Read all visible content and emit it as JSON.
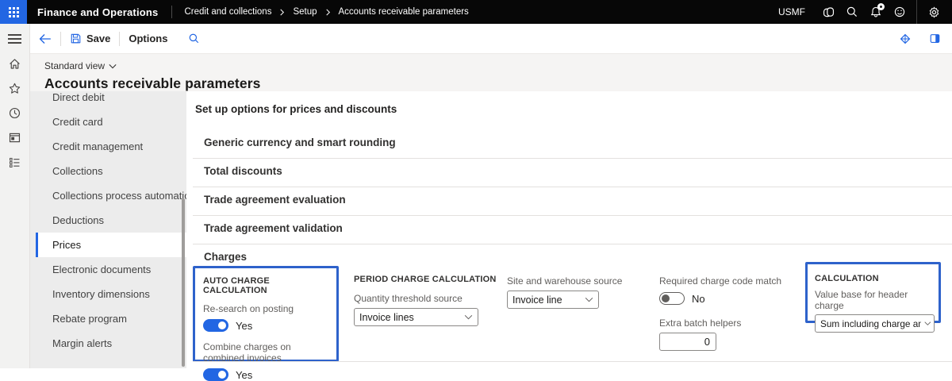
{
  "topbar": {
    "app_name": "Finance and Operations",
    "breadcrumb": [
      "Credit and collections",
      "Setup",
      "Accounts receivable parameters"
    ],
    "company": "USMF",
    "icons": {
      "waffle": "app-launcher",
      "copilot": "copilot",
      "search": "search",
      "alerts": "notification-bell",
      "feedback": "feedback-smiley",
      "settings": "gear"
    }
  },
  "action_bar": {
    "save_label": "Save",
    "options_label": "Options",
    "icons": {
      "back": "back-arrow",
      "save": "floppy-disk",
      "search": "search",
      "right1": "diamond",
      "right2": "side-panel-toggle"
    }
  },
  "page": {
    "view_selector": "Standard view",
    "title": "Accounts receivable parameters"
  },
  "nav_rail": {
    "icons": [
      "menu-hamburger",
      "home",
      "favorites-star",
      "recent-clock",
      "worklist-window",
      "nav-list"
    ]
  },
  "sidebar": {
    "items": [
      "Direct debit",
      "Credit card",
      "Credit management",
      "Collections",
      "Collections process automation",
      "Deductions",
      "Prices",
      "Electronic documents",
      "Inventory dimensions",
      "Rebate program",
      "Margin alerts"
    ],
    "selected": "Prices"
  },
  "content": {
    "heading": "Set up options for prices and discounts",
    "sections": [
      "Generic currency and smart rounding",
      "Total discounts",
      "Trade agreement evaluation",
      "Trade agreement validation",
      "Charges"
    ],
    "charges": {
      "auto_charge": {
        "title": "AUTO CHARGE CALCULATION",
        "highlighted": true,
        "toggles": [
          {
            "label": "Re-search on posting",
            "value": "Yes",
            "on": true
          },
          {
            "label": "Combine charges on combined invoices",
            "value": "Yes",
            "on": true
          }
        ]
      },
      "period_charge": {
        "title": "PERIOD CHARGE CALCULATION",
        "field": {
          "label": "Quantity threshold source",
          "value": "Invoice lines"
        }
      },
      "site_warehouse": {
        "label": "Site and warehouse source",
        "value": "Invoice line"
      },
      "charge_code": {
        "label": "Required charge code match",
        "value": "No",
        "on": false
      },
      "batch_helpers": {
        "label": "Extra batch helpers",
        "value": "0"
      },
      "calculation": {
        "title": "CALCULATION",
        "highlighted": true,
        "field": {
          "label": "Value base for header charge",
          "value": "Sum including charge amounts"
        }
      }
    }
  },
  "colors": {
    "accent": "#2266e3",
    "highlight_border": "#2e62cb",
    "topbar_bg": "#070707",
    "toggle_on": "#2266e3"
  }
}
